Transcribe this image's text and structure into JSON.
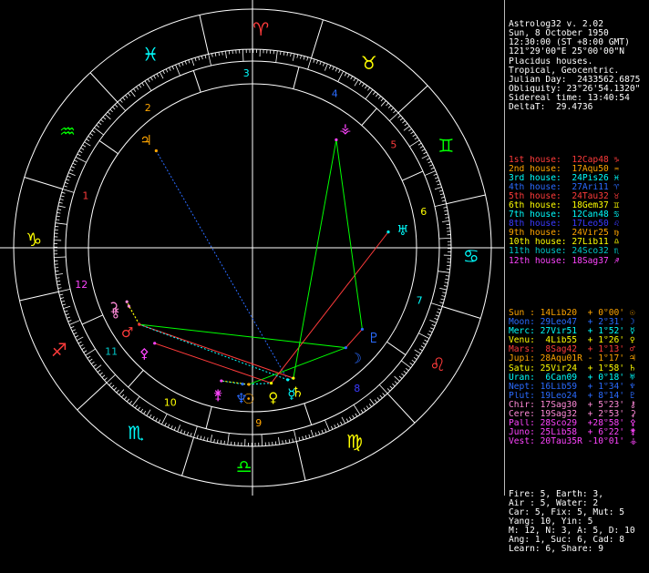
{
  "header": [
    "Astrolog32 v. 2.02",
    "Sun, 8 October 1950",
    "12:30:00 (ST +8:00 GMT)",
    "121°29'00\"E 25°00'00\"N",
    "Placidus houses.",
    "Tropical, Geocentric.",
    "Julian Day:  2433562.6875",
    "Obliquity: 23°26'54.1320\"",
    "Sidereal time: 13:40:54",
    "DeltaT:  29.4736"
  ],
  "houses": [
    {
      "label": "1st house:",
      "value": "12Cap48",
      "color": "red"
    },
    {
      "label": "2nd house:",
      "value": "17Aqu50",
      "color": "orange"
    },
    {
      "label": "3rd house:",
      "value": "24Pis26",
      "color": "cyan"
    },
    {
      "label": "4th house:",
      "value": "27Ari11",
      "color": "blue"
    },
    {
      "label": "5th house:",
      "value": "24Tau32",
      "color": "red"
    },
    {
      "label": "6th house:",
      "value": "18Gem37",
      "color": "yellow"
    },
    {
      "label": "7th house:",
      "value": "12Can48",
      "color": "cyan"
    },
    {
      "label": "8th house:",
      "value": "17Leo50",
      "color": "dblue"
    },
    {
      "label": "9th house:",
      "value": "24Vir25",
      "color": "orange"
    },
    {
      "label": "10th house:",
      "value": "27Lib11",
      "color": "yellow"
    },
    {
      "label": "11th house:",
      "value": "24Sco32",
      "color": "teal"
    },
    {
      "label": "12th house:",
      "value": "18Sag37",
      "color": "magenta"
    }
  ],
  "planets": [
    {
      "name": "Sun :",
      "pos": "14Lib20",
      "rate": "+ 0°00'",
      "glyph": "☉",
      "color": "orange"
    },
    {
      "name": "Moon:",
      "pos": "29Leo47",
      "rate": "+ 2°31'",
      "glyph": "☽",
      "color": "blue"
    },
    {
      "name": "Merc:",
      "pos": "27Vir51",
      "rate": "+ 1°52'",
      "glyph": "☿",
      "color": "cyan"
    },
    {
      "name": "Venu:",
      "pos": " 4Lib55",
      "rate": "+ 1°26'",
      "glyph": "♀",
      "color": "yellow"
    },
    {
      "name": "Mars:",
      "pos": " 8Sag42",
      "rate": "+ 1°13'",
      "glyph": "♂",
      "color": "red"
    },
    {
      "name": "Jupi:",
      "pos": "28Aqu01R",
      "rate": "- 1°17'",
      "glyph": "♃",
      "color": "orange"
    },
    {
      "name": "Satu:",
      "pos": "25Vir24",
      "rate": "+ 1°58'",
      "glyph": "♄",
      "color": "yellow"
    },
    {
      "name": "Uran:",
      "pos": " 6Can09",
      "rate": "+ 0°18'",
      "glyph": "♅",
      "color": "cyan"
    },
    {
      "name": "Nept:",
      "pos": "16Lib59",
      "rate": "+ 1°34'",
      "glyph": "♆",
      "color": "blue"
    },
    {
      "name": "Plut:",
      "pos": "19Leo24",
      "rate": "+ 8°14'",
      "glyph": "♇",
      "color": "blue"
    },
    {
      "name": "Chir:",
      "pos": "17Sag30",
      "rate": "+ 5°23'",
      "glyph": "⚷",
      "color": "pink"
    },
    {
      "name": "Cere:",
      "pos": "19Sag32",
      "rate": "+ 2°53'",
      "glyph": "⚳",
      "color": "pink"
    },
    {
      "name": "Pall:",
      "pos": "28Sco29",
      "rate": "+28°58'",
      "glyph": "⚴",
      "color": "magenta"
    },
    {
      "name": "Juno:",
      "pos": "25Lib58",
      "rate": "+ 6°22'",
      "glyph": "⚵",
      "color": "magenta"
    },
    {
      "name": "Vest:",
      "pos": "20Tau35R",
      "rate": "-10°01'",
      "glyph": "⚶",
      "color": "magenta"
    }
  ],
  "summary": [
    "Fire: 5, Earth: 3,",
    "Air : 5, Water: 2",
    "Car: 5, Fix: 5, Mut: 5",
    "Yang: 10, Yin: 5",
    "M: 12, N: 3, A: 5, D: 10",
    "Ang: 1, Suc: 6, Cad: 8",
    "Learn: 6, Share: 9"
  ],
  "wheel": {
    "house_numbers": [
      "1",
      "2",
      "3",
      "4",
      "5",
      "6",
      "7",
      "8",
      "9",
      "10",
      "11",
      "12"
    ],
    "sign_glyphs": [
      "♈",
      "♉",
      "♊",
      "♋",
      "♌",
      "♍",
      "♎",
      "♏",
      "♐",
      "♑",
      "♒",
      "♓"
    ],
    "colors": {
      "red": "#ff3b3b",
      "orange": "#ffa500",
      "green": "#00ff00",
      "blue": "#2a6bff",
      "cyan": "#00ffff",
      "yellow": "#ffff00",
      "magenta": "#ff44ff",
      "white": "#ffffff",
      "pink": "#ff8ad8",
      "dblue": "#3a3aff",
      "teal": "#00c8c8",
      "gray": "#a0a0a0"
    }
  }
}
